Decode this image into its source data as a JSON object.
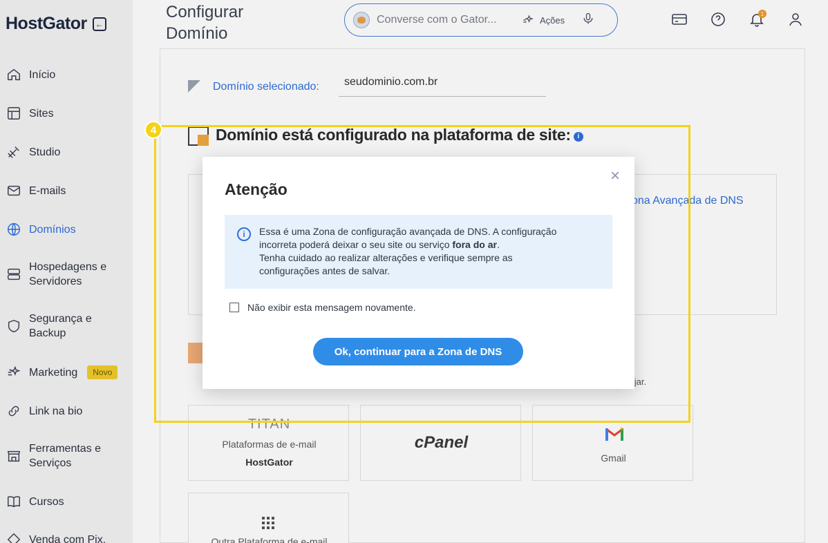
{
  "sidebar": {
    "logo": "HostGator",
    "items": [
      {
        "label": "Início",
        "icon": "home-icon"
      },
      {
        "label": "Sites",
        "icon": "layout-icon"
      },
      {
        "label": "Studio",
        "icon": "studio-icon"
      },
      {
        "label": "E-mails",
        "icon": "mail-icon"
      },
      {
        "label": "Domínios",
        "icon": "globe-icon",
        "active": true
      },
      {
        "label": "Hospedagens e Servidores",
        "icon": "server-icon"
      },
      {
        "label": "Segurança e Backup",
        "icon": "shield-icon"
      },
      {
        "label": "Marketing",
        "icon": "sparkle-icon",
        "badge": "Novo"
      },
      {
        "label": "Link na bio",
        "icon": "link-icon"
      },
      {
        "label": "Ferramentas e Serviços",
        "icon": "store-icon"
      },
      {
        "label": "Cursos",
        "icon": "book-icon"
      },
      {
        "label": "Venda com Pix,",
        "icon": "pix-icon"
      }
    ]
  },
  "header": {
    "title": "Configurar Domínio",
    "search_placeholder": "Converse com o Gator...",
    "actions_label": "Ações",
    "notification_count": "1"
  },
  "main": {
    "domain_label": "Domínio selecionado:",
    "domain_value": "seudominio.com.br",
    "section_title": "Domínio está configurado na plataforma de site:",
    "dns_link": "ona Avançada de DNS",
    "desc_tail": "sejar.",
    "email_platforms": [
      {
        "logo": "TITAN",
        "line1": "Plataformas de e-mail",
        "line2": "HostGator"
      },
      {
        "logo": "cPanel"
      },
      {
        "label": "Gmail"
      },
      {
        "label": "Outra Plataforma de e-mail"
      }
    ]
  },
  "tutorial": {
    "step": "4"
  },
  "modal": {
    "title": "Atenção",
    "alert_line1": "Essa é uma Zona de configuração avançada de DNS. A configuração",
    "alert_line2_pre": "incorreta poderá deixar o seu site ou serviço ",
    "alert_line2_bold": "fora do ar",
    "alert_line2_post": ".",
    "alert_line3": "Tenha cuidado ao realizar alterações e verifique sempre as",
    "alert_line4": "configurações antes de salvar.",
    "checkbox_label": "Não exibir esta mensagem novamente.",
    "ok_button": "Ok, continuar para a Zona de DNS"
  },
  "colors": {
    "accent": "#2f6fdc",
    "button": "#2f8de8",
    "highlight": "#f5d21a",
    "alert_bg": "#e6f1fb"
  }
}
